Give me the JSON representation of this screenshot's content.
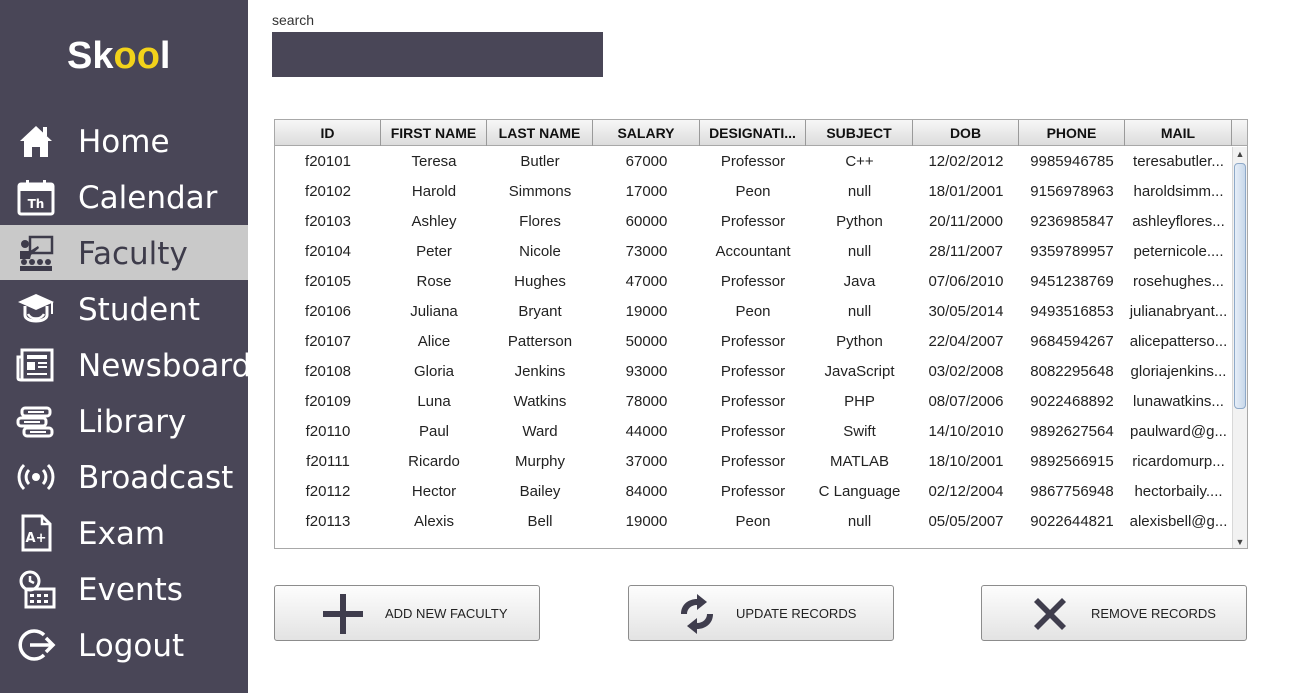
{
  "app": {
    "logo_prefix": "Sk",
    "logo_highlight": "oo",
    "logo_suffix": "l"
  },
  "sidebar": {
    "items": [
      {
        "label": "Home",
        "icon": "home-icon"
      },
      {
        "label": "Calendar",
        "icon": "calendar-icon",
        "icon_text": "Th"
      },
      {
        "label": "Faculty",
        "icon": "faculty-icon",
        "active": true
      },
      {
        "label": "Student",
        "icon": "graduation-cap-icon"
      },
      {
        "label": "Newsboard",
        "icon": "newspaper-icon"
      },
      {
        "label": "Library",
        "icon": "books-icon"
      },
      {
        "label": "Broadcast",
        "icon": "broadcast-icon"
      },
      {
        "label": "Exam",
        "icon": "exam-icon",
        "icon_text": "A+"
      },
      {
        "label": "Events",
        "icon": "events-icon"
      },
      {
        "label": "Logout",
        "icon": "logout-icon"
      }
    ]
  },
  "search": {
    "label": "search",
    "value": ""
  },
  "table": {
    "columns": [
      "ID",
      "FIRST NAME",
      "LAST NAME",
      "SALARY",
      "DESIGNATI...",
      "SUBJECT",
      "DOB",
      "PHONE",
      "MAIL"
    ],
    "rows": [
      [
        "f20101",
        "Teresa",
        "Butler",
        "67000",
        "Professor",
        "C++",
        "12/02/2012",
        "9985946785",
        "teresabutler..."
      ],
      [
        "f20102",
        "Harold",
        "Simmons",
        "17000",
        "Peon",
        "null",
        "18/01/2001",
        "9156978963",
        "haroldsimm..."
      ],
      [
        "f20103",
        "Ashley",
        "Flores",
        "60000",
        "Professor",
        "Python",
        "20/11/2000",
        "9236985847",
        "ashleyflores..."
      ],
      [
        "f20104",
        "Peter",
        "Nicole",
        "73000",
        "Accountant",
        "null",
        "28/11/2007",
        "9359789957",
        "peternicole...."
      ],
      [
        "f20105",
        "Rose",
        "Hughes",
        "47000",
        "Professor",
        "Java",
        "07/06/2010",
        "9451238769",
        "rosehughes..."
      ],
      [
        "f20106",
        "Juliana",
        "Bryant",
        "19000",
        "Peon",
        "null",
        "30/05/2014",
        "9493516853",
        "julianabryant..."
      ],
      [
        "f20107",
        "Alice",
        "Patterson",
        "50000",
        "Professor",
        "Python",
        "22/04/2007",
        "9684594267",
        "alicepatterso..."
      ],
      [
        "f20108",
        "Gloria",
        "Jenkins",
        "93000",
        "Professor",
        "JavaScript",
        "03/02/2008",
        "8082295648",
        "gloriajenkins..."
      ],
      [
        "f20109",
        "Luna",
        "Watkins",
        "78000",
        "Professor",
        "PHP",
        "08/07/2006",
        "9022468892",
        "lunawatkins..."
      ],
      [
        "f20110",
        "Paul",
        "Ward",
        "44000",
        "Professor",
        "Swift",
        "14/10/2010",
        "9892627564",
        "paulward@g..."
      ],
      [
        "f20111",
        "Ricardo",
        "Murphy",
        "37000",
        "Professor",
        "MATLAB",
        "18/10/2001",
        "9892566915",
        "ricardomurp..."
      ],
      [
        "f20112",
        "Hector",
        "Bailey",
        "84000",
        "Professor",
        "C Language",
        "02/12/2004",
        "9867756948",
        "hectorbaily...."
      ],
      [
        "f20113",
        "Alexis",
        "Bell",
        "19000",
        "Peon",
        "null",
        "05/05/2007",
        "9022644821",
        "alexisbell@g..."
      ]
    ],
    "scroll_up_glyph": "▲",
    "scroll_down_glyph": "▼"
  },
  "buttons": {
    "add": {
      "label": "ADD NEW FACULTY",
      "icon": "plus-icon"
    },
    "update": {
      "label": "UPDATE RECORDS",
      "icon": "refresh-icon"
    },
    "remove": {
      "label": "REMOVE RECORDS",
      "icon": "close-icon"
    }
  },
  "colors": {
    "sidebar_bg": "#494657",
    "active_bg": "#c9c9c9",
    "logo_accent": "#f2d21a",
    "button_icon": "#3f3d4d"
  }
}
